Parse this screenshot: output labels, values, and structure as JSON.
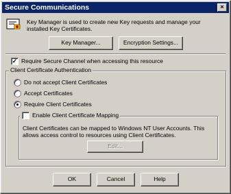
{
  "window": {
    "title": "Secure Communications",
    "close_glyph": "×"
  },
  "description": "Key Manager is used to create new Key requests and manage your installed Key Certificates.",
  "icons": {
    "key_icon": "key-certificate-icon"
  },
  "buttons": {
    "key_manager": "Key Manager...",
    "encryption_settings": "Encryption Settings...",
    "edit": "Edit...",
    "ok": "OK",
    "cancel": "Cancel",
    "help": "Help"
  },
  "require_secure_channel": {
    "label": "Require Secure Channel when accessing this resource",
    "checked": true
  },
  "client_cert_auth": {
    "title": "Client Certificate Authentication",
    "options": [
      {
        "label": "Do not accept Client Certificates",
        "selected": false
      },
      {
        "label": "Accept Certificates",
        "selected": false
      },
      {
        "label": "Require Client Certificates",
        "selected": true
      }
    ],
    "mapping": {
      "label": "Enable Client Certificate Mapping",
      "checked": false,
      "description": "Client Certificates can be mapped to Windows NT User Accounts.  This allows access control to resources using Client Certificates."
    }
  }
}
